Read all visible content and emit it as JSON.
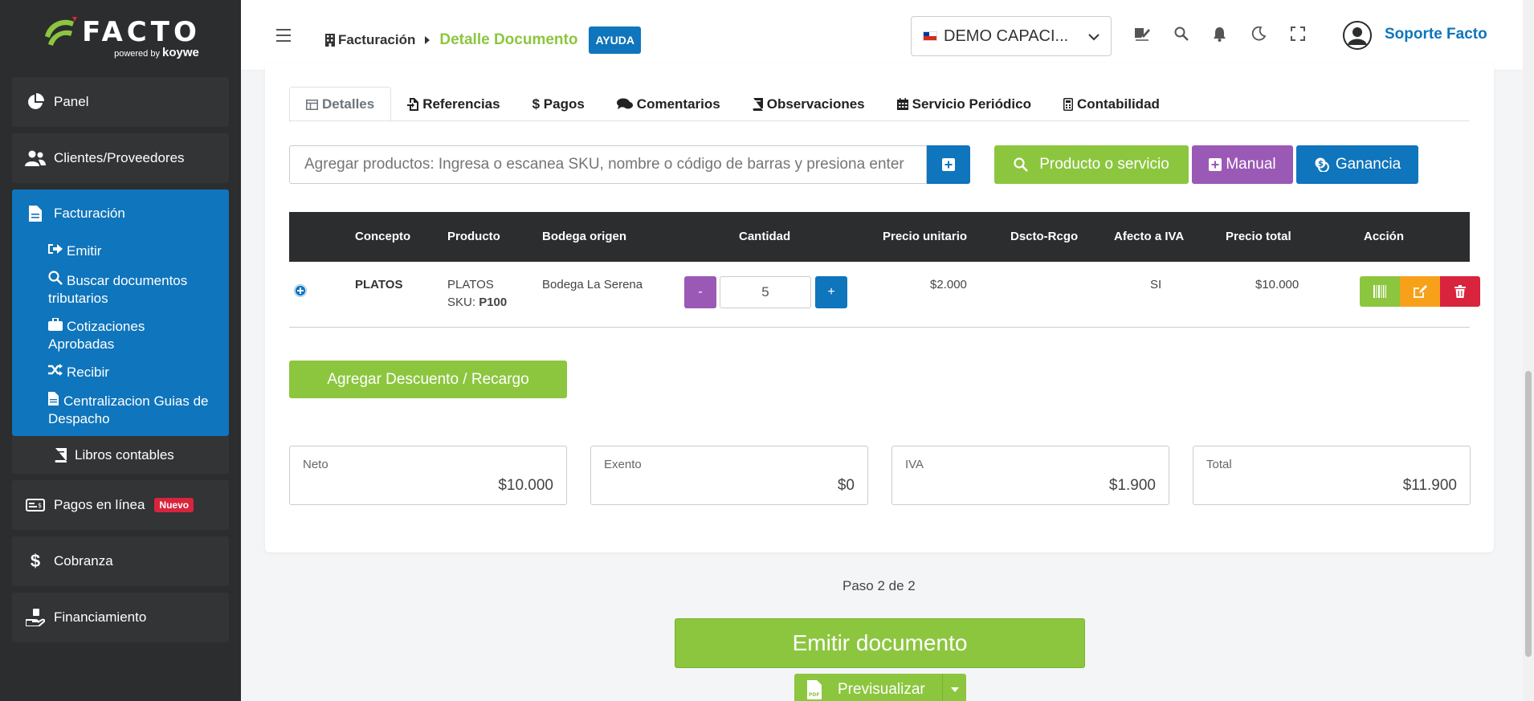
{
  "logo": {
    "name": "FACTO",
    "powered": "powered",
    "by": "by",
    "brand": "koywe"
  },
  "sidebar": {
    "items": [
      {
        "label": "Panel",
        "icon": "pie-chart-icon"
      },
      {
        "label": "Clientes/Proveedores",
        "icon": "users-icon"
      },
      {
        "label": "Facturación",
        "icon": "file-icon"
      },
      {
        "label": "Pagos en línea",
        "icon": "card-icon",
        "badge": "Nuevo"
      },
      {
        "label": "Cobranza",
        "icon": "dollar-icon"
      },
      {
        "label": "Financiamiento",
        "icon": "hand-money-icon"
      }
    ],
    "sub": [
      {
        "label": "Emitir"
      },
      {
        "label": "Buscar documentos tributarios"
      },
      {
        "label": "Cotizaciones Aprobadas"
      },
      {
        "label": "Recibir"
      },
      {
        "label": "Centralizacion Guias de Despacho"
      }
    ],
    "libros": "Libros contables"
  },
  "header": {
    "crumb1": "Facturación",
    "crumb2": "Detalle Documento",
    "help": "AYUDA",
    "company": "DEMO CAPACI...",
    "user": "Soporte Facto"
  },
  "tabs": [
    "Detalles",
    "Referencias",
    "$ Pagos",
    "Comentarios",
    "Observaciones",
    "Servicio Periódico",
    "Contabilidad"
  ],
  "search": {
    "placeholder": "Agregar productos: Ingresa o escanea SKU, nombre o código de barras y presiona enter"
  },
  "buttons": {
    "producto": "Producto o servicio",
    "manual": "Manual",
    "ganancia": "Ganancia",
    "descuento": "Agregar Descuento / Recargo",
    "emitir": "Emitir documento",
    "previsualizar": "Previsualizar"
  },
  "table": {
    "headers": [
      "Concepto",
      "Producto",
      "Bodega origen",
      "Cantidad",
      "Precio unitario",
      "Dscto-Rcgo",
      "Afecto a IVA",
      "Precio total",
      "Acción"
    ],
    "row": {
      "concepto": "PLATOS",
      "producto": "PLATOS",
      "sku_label": "SKU:",
      "sku": "P100",
      "bodega": "Bodega La Serena",
      "minus": "-",
      "cantidad": "5",
      "plus": "+",
      "precio_unitario": "$2.000",
      "dscto": "",
      "afecto": "SI",
      "precio_total": "$10.000"
    }
  },
  "totals": [
    {
      "label": "Neto",
      "value": "$10.000"
    },
    {
      "label": "Exento",
      "value": "$0"
    },
    {
      "label": "IVA",
      "value": "$1.900"
    },
    {
      "label": "Total",
      "value": "$11.900"
    }
  ],
  "footer": {
    "paso": "Paso 2 de 2"
  },
  "colors": {
    "primary": "#0f75bc",
    "green": "#8cc63f",
    "purple": "#9b59b6",
    "orange": "#f7a11a",
    "red": "#d8243c",
    "sidebar": "#2b2d2e"
  }
}
